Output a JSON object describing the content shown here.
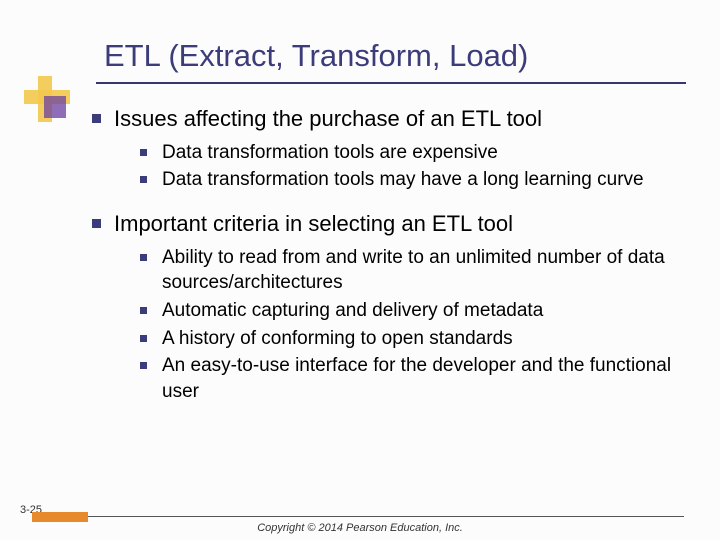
{
  "title": "ETL (Extract, Transform, Load)",
  "sections": [
    {
      "heading": "Issues affecting the purchase of an ETL tool",
      "items": [
        "Data transformation tools are expensive",
        "Data transformation tools may have a long learning curve"
      ]
    },
    {
      "heading": "Important criteria in selecting an ETL tool",
      "items": [
        "Ability to read from and write to an unlimited number of data sources/architectures",
        "Automatic capturing and delivery of metadata",
        "A history of conforming to open standards",
        "An easy-to-use interface for the developer and the functional user"
      ]
    }
  ],
  "page_number": "3-25",
  "copyright": "Copyright © 2014 Pearson Education, Inc."
}
